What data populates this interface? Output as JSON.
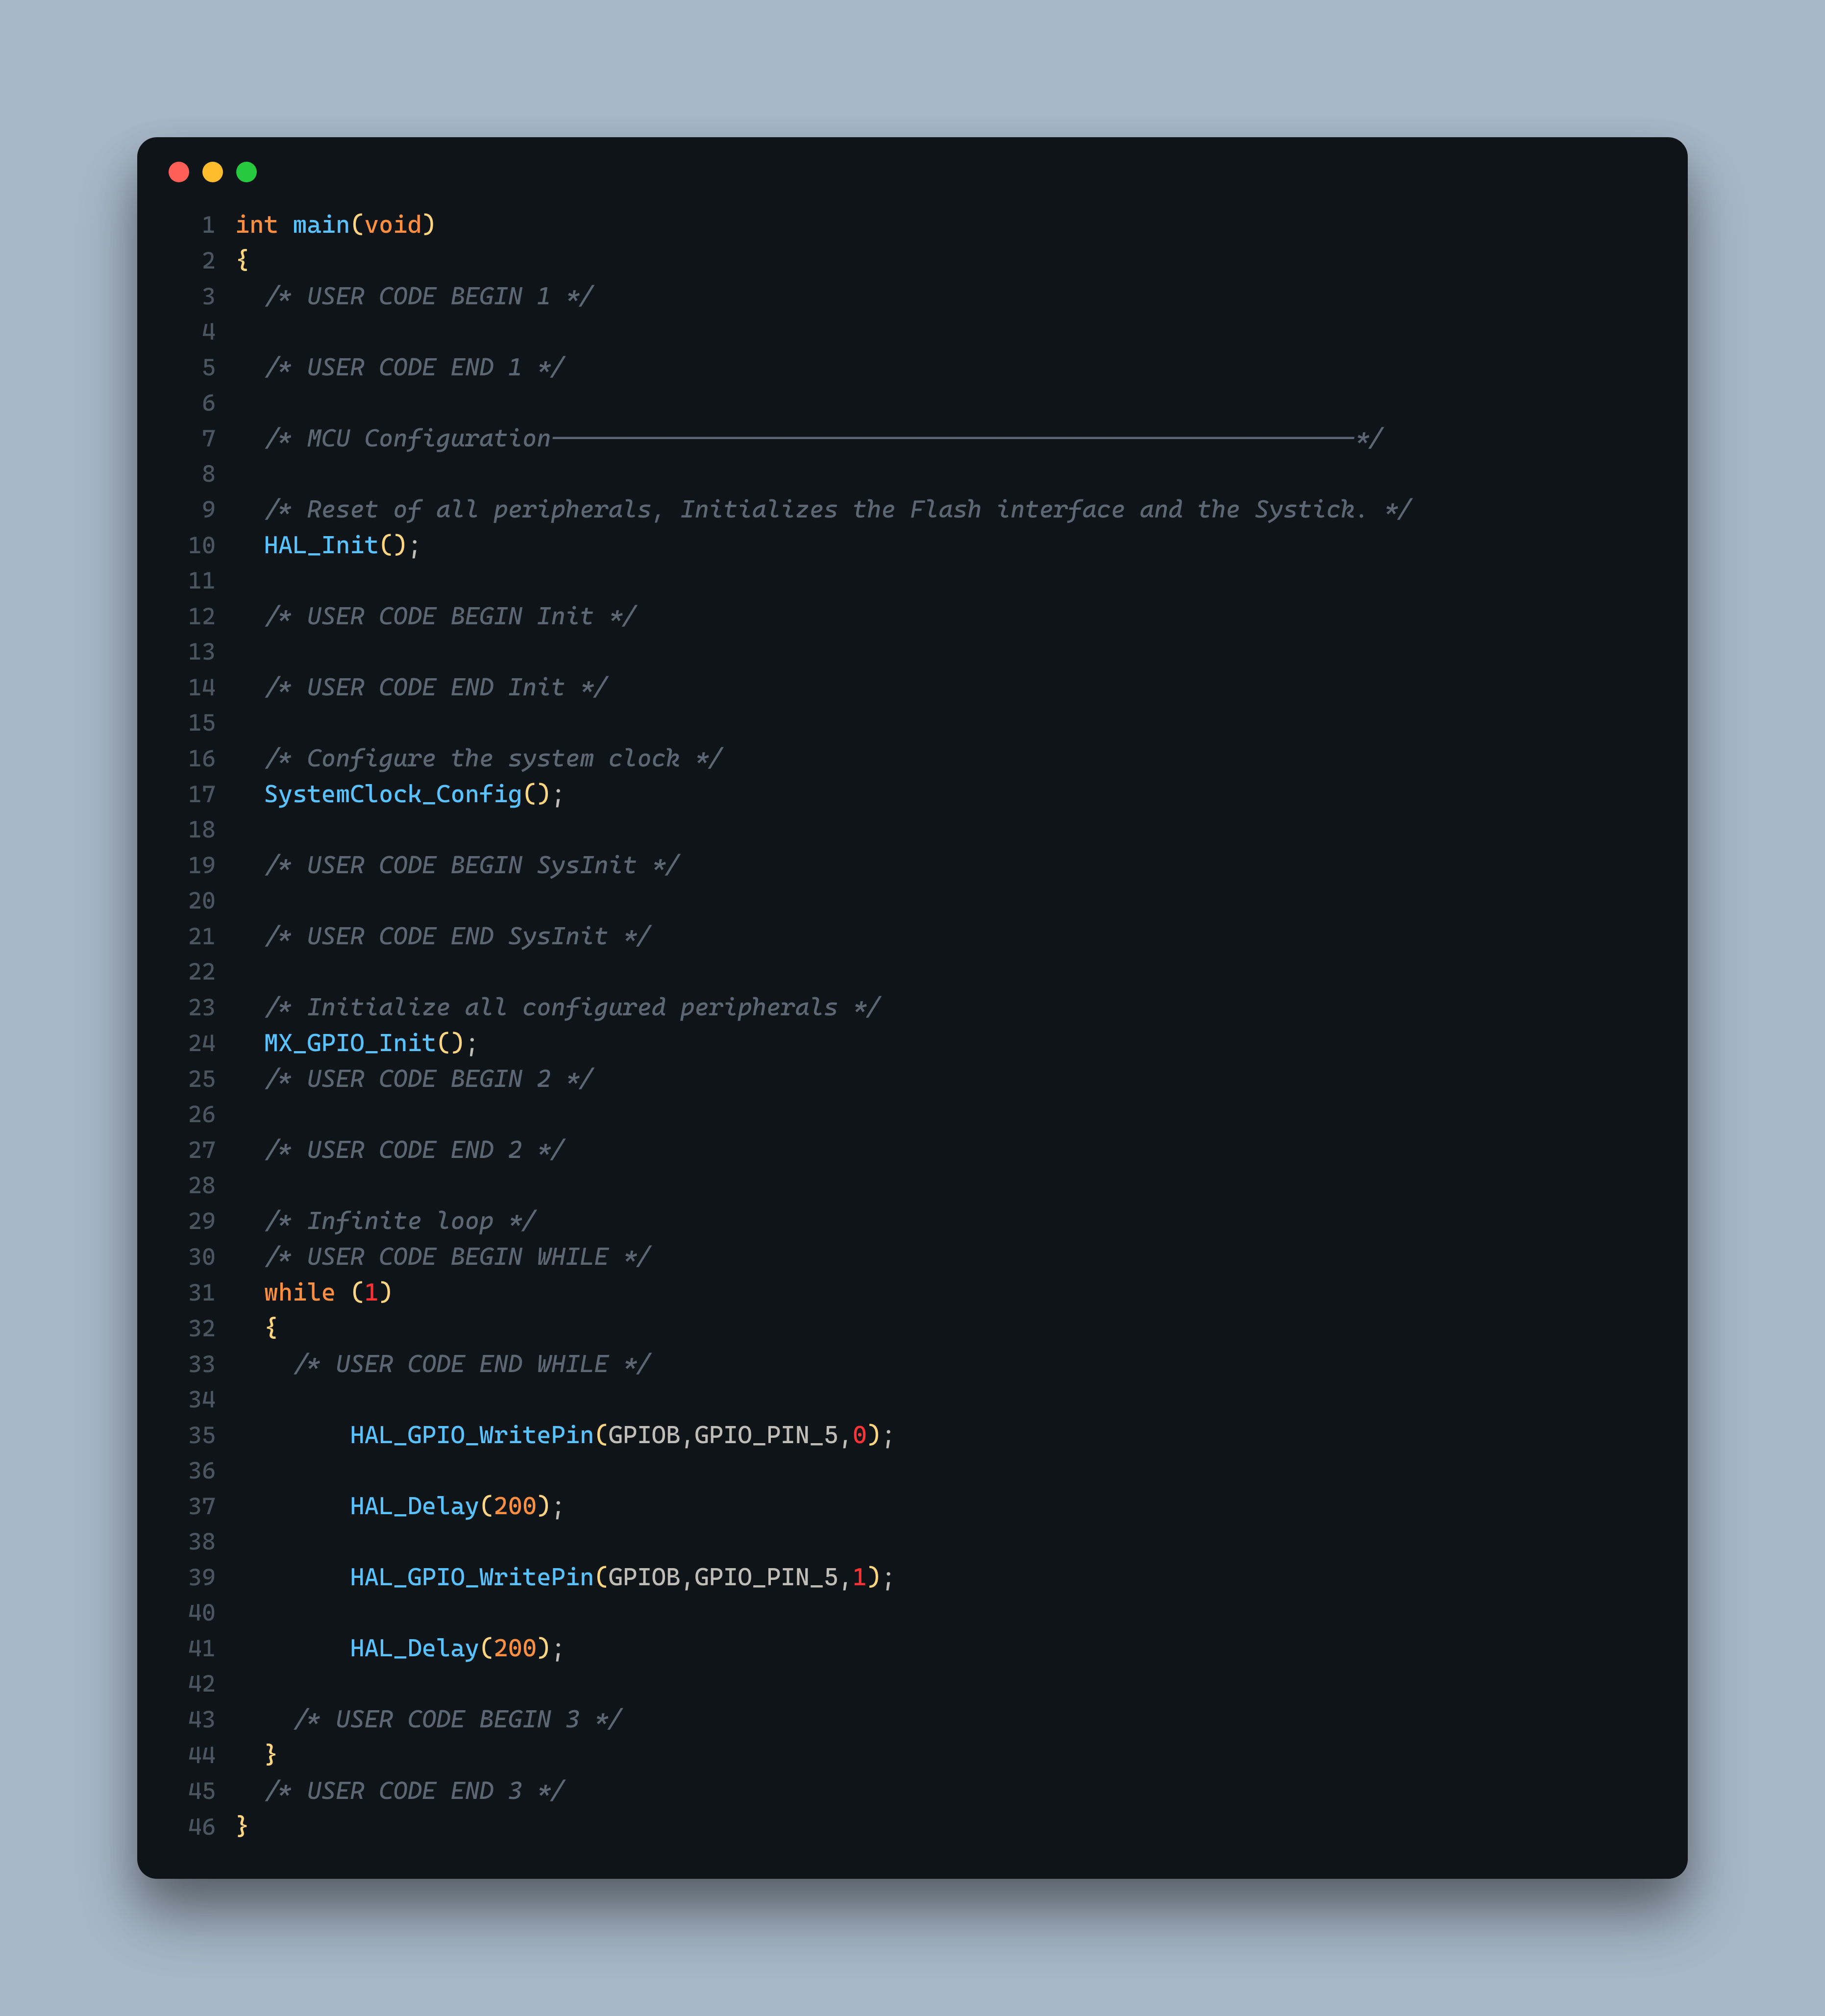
{
  "window_controls": {
    "close": "close",
    "minimize": "minimize",
    "maximize": "maximize"
  },
  "colors": {
    "bg_page": "#a8b8c8",
    "bg_window": "#0f1419",
    "gutter": "#4a5560",
    "comment": "#5c6773",
    "keyword": "#ff8f40",
    "function": "#59c2ff",
    "paren": "#ffd580",
    "text": "#bfbdb6"
  },
  "lines": [
    {
      "n": "1",
      "t": [
        [
          "kw",
          "int"
        ],
        [
          "punct",
          " "
        ],
        [
          "fn",
          "main"
        ],
        [
          "paren",
          "("
        ],
        [
          "kw",
          "void"
        ],
        [
          "paren",
          ")"
        ]
      ]
    },
    {
      "n": "2",
      "t": [
        [
          "paren",
          "{"
        ]
      ]
    },
    {
      "n": "3",
      "t": [
        [
          "punct",
          "  "
        ],
        [
          "comment",
          "/* USER CODE BEGIN 1 */"
        ]
      ]
    },
    {
      "n": "4",
      "t": []
    },
    {
      "n": "5",
      "t": [
        [
          "punct",
          "  "
        ],
        [
          "comment",
          "/* USER CODE END 1 */"
        ]
      ]
    },
    {
      "n": "6",
      "t": []
    },
    {
      "n": "7",
      "t": [
        [
          "punct",
          "  "
        ],
        [
          "comment",
          "/* MCU Configuration--------------------------------------------------------*/"
        ]
      ]
    },
    {
      "n": "8",
      "t": []
    },
    {
      "n": "9",
      "t": [
        [
          "punct",
          "  "
        ],
        [
          "comment",
          "/* Reset of all peripherals, Initializes the Flash interface and the Systick. */"
        ]
      ]
    },
    {
      "n": "10",
      "t": [
        [
          "punct",
          "  "
        ],
        [
          "fn",
          "HAL_Init"
        ],
        [
          "paren",
          "()"
        ],
        [
          "punct",
          ";"
        ]
      ]
    },
    {
      "n": "11",
      "t": []
    },
    {
      "n": "12",
      "t": [
        [
          "punct",
          "  "
        ],
        [
          "comment",
          "/* USER CODE BEGIN Init */"
        ]
      ]
    },
    {
      "n": "13",
      "t": []
    },
    {
      "n": "14",
      "t": [
        [
          "punct",
          "  "
        ],
        [
          "comment",
          "/* USER CODE END Init */"
        ]
      ]
    },
    {
      "n": "15",
      "t": []
    },
    {
      "n": "16",
      "t": [
        [
          "punct",
          "  "
        ],
        [
          "comment",
          "/* Configure the system clock */"
        ]
      ]
    },
    {
      "n": "17",
      "t": [
        [
          "punct",
          "  "
        ],
        [
          "fn",
          "SystemClock_Config"
        ],
        [
          "paren",
          "()"
        ],
        [
          "punct",
          ";"
        ]
      ]
    },
    {
      "n": "18",
      "t": []
    },
    {
      "n": "19",
      "t": [
        [
          "punct",
          "  "
        ],
        [
          "comment",
          "/* USER CODE BEGIN SysInit */"
        ]
      ]
    },
    {
      "n": "20",
      "t": []
    },
    {
      "n": "21",
      "t": [
        [
          "punct",
          "  "
        ],
        [
          "comment",
          "/* USER CODE END SysInit */"
        ]
      ]
    },
    {
      "n": "22",
      "t": []
    },
    {
      "n": "23",
      "t": [
        [
          "punct",
          "  "
        ],
        [
          "comment",
          "/* Initialize all configured peripherals */"
        ]
      ]
    },
    {
      "n": "24",
      "t": [
        [
          "punct",
          "  "
        ],
        [
          "fn",
          "MX_GPIO_Init"
        ],
        [
          "paren",
          "()"
        ],
        [
          "punct",
          ";"
        ]
      ]
    },
    {
      "n": "25",
      "t": [
        [
          "punct",
          "  "
        ],
        [
          "comment",
          "/* USER CODE BEGIN 2 */"
        ]
      ]
    },
    {
      "n": "26",
      "t": []
    },
    {
      "n": "27",
      "t": [
        [
          "punct",
          "  "
        ],
        [
          "comment",
          "/* USER CODE END 2 */"
        ]
      ]
    },
    {
      "n": "28",
      "t": []
    },
    {
      "n": "29",
      "t": [
        [
          "punct",
          "  "
        ],
        [
          "comment",
          "/* Infinite loop */"
        ]
      ]
    },
    {
      "n": "30",
      "t": [
        [
          "punct",
          "  "
        ],
        [
          "comment",
          "/* USER CODE BEGIN WHILE */"
        ]
      ]
    },
    {
      "n": "31",
      "t": [
        [
          "punct",
          "  "
        ],
        [
          "kw",
          "while"
        ],
        [
          "punct",
          " "
        ],
        [
          "paren",
          "("
        ],
        [
          "zero",
          "1"
        ],
        [
          "paren",
          ")"
        ]
      ]
    },
    {
      "n": "32",
      "t": [
        [
          "punct",
          "  "
        ],
        [
          "paren",
          "{"
        ]
      ]
    },
    {
      "n": "33",
      "t": [
        [
          "punct",
          "    "
        ],
        [
          "comment",
          "/* USER CODE END WHILE */"
        ]
      ]
    },
    {
      "n": "34",
      "t": []
    },
    {
      "n": "35",
      "t": [
        [
          "punct",
          "        "
        ],
        [
          "fn",
          "HAL_GPIO_WritePin"
        ],
        [
          "paren",
          "("
        ],
        [
          "const",
          "GPIOB"
        ],
        [
          "punct",
          ","
        ],
        [
          "const",
          "GPIO_PIN_5"
        ],
        [
          "punct",
          ","
        ],
        [
          "zero",
          "0"
        ],
        [
          "paren",
          ")"
        ],
        [
          "punct",
          ";"
        ]
      ]
    },
    {
      "n": "36",
      "t": []
    },
    {
      "n": "37",
      "t": [
        [
          "punct",
          "        "
        ],
        [
          "fn",
          "HAL_Delay"
        ],
        [
          "paren",
          "("
        ],
        [
          "num",
          "200"
        ],
        [
          "paren",
          ")"
        ],
        [
          "punct",
          ";"
        ]
      ]
    },
    {
      "n": "38",
      "t": []
    },
    {
      "n": "39",
      "t": [
        [
          "punct",
          "        "
        ],
        [
          "fn",
          "HAL_GPIO_WritePin"
        ],
        [
          "paren",
          "("
        ],
        [
          "const",
          "GPIOB"
        ],
        [
          "punct",
          ","
        ],
        [
          "const",
          "GPIO_PIN_5"
        ],
        [
          "punct",
          ","
        ],
        [
          "zero",
          "1"
        ],
        [
          "paren",
          ")"
        ],
        [
          "punct",
          ";"
        ]
      ]
    },
    {
      "n": "40",
      "t": []
    },
    {
      "n": "41",
      "t": [
        [
          "punct",
          "        "
        ],
        [
          "fn",
          "HAL_Delay"
        ],
        [
          "paren",
          "("
        ],
        [
          "num",
          "200"
        ],
        [
          "paren",
          ")"
        ],
        [
          "punct",
          ";"
        ]
      ]
    },
    {
      "n": "42",
      "t": []
    },
    {
      "n": "43",
      "t": [
        [
          "punct",
          "    "
        ],
        [
          "comment",
          "/* USER CODE BEGIN 3 */"
        ]
      ]
    },
    {
      "n": "44",
      "t": [
        [
          "punct",
          "  "
        ],
        [
          "paren",
          "}"
        ]
      ]
    },
    {
      "n": "45",
      "t": [
        [
          "punct",
          "  "
        ],
        [
          "comment",
          "/* USER CODE END 3 */"
        ]
      ]
    },
    {
      "n": "46",
      "t": [
        [
          "paren",
          "}"
        ]
      ]
    }
  ]
}
